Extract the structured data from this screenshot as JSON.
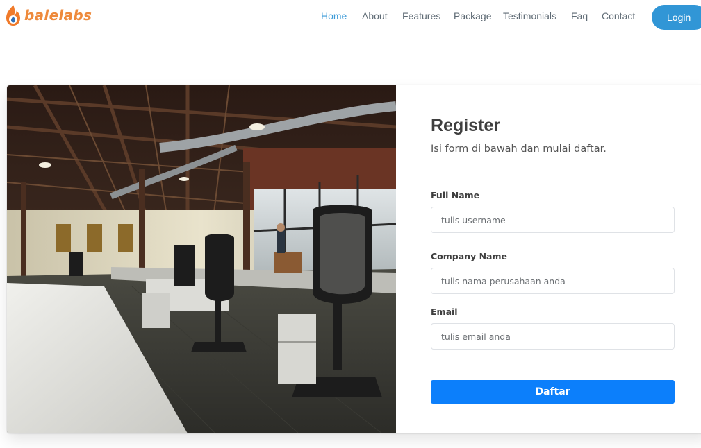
{
  "brand": {
    "name": "balelabs",
    "logo_icon": "flame-icon",
    "accent": "#ee8a3c"
  },
  "nav": {
    "items": [
      {
        "label": "Home",
        "active": true
      },
      {
        "label": "About"
      },
      {
        "label": "Features"
      },
      {
        "label": "Package"
      },
      {
        "label": "Testimonials"
      },
      {
        "label": "Faq"
      },
      {
        "label": "Contact"
      }
    ],
    "login_label": "Login",
    "active_color": "#3d9bd8",
    "login_color": "#3196d6"
  },
  "register": {
    "title": "Register",
    "subtitle": "Isi form di bawah dan mulai daftar.",
    "fields": {
      "full_name": {
        "label": "Full Name",
        "placeholder": "tulis username",
        "value": ""
      },
      "company": {
        "label": "Company Name",
        "placeholder": "tulis nama perusahaan anda",
        "value": ""
      },
      "email": {
        "label": "Email",
        "placeholder": "tulis email anda",
        "value": ""
      }
    },
    "submit_label": "Daftar",
    "submit_color": "#0c7ffb"
  },
  "hero_image": {
    "subject": "office-interior-photo"
  }
}
